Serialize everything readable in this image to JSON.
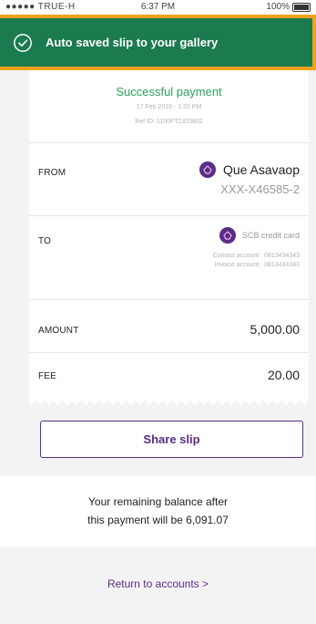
{
  "status_bar": {
    "carrier": "●●●●● TRUE-H",
    "time": "6:37 PM",
    "battery": "100%"
  },
  "toast": {
    "message": "Auto saved slip to your gallery"
  },
  "slip": {
    "status": "Successful payment",
    "date": "17 Feb 2016 - 1:20 PM",
    "ref": "Ref ID: 1100FT2325802",
    "from": {
      "label": "FROM",
      "name": "Que Asavaop",
      "account": "XXX-X46585-2"
    },
    "to": {
      "label": "TO",
      "name": "SCB credit card",
      "contact": "Contact account : 0813434343",
      "invoice": "Invoice account : 0813434343"
    },
    "amount": {
      "label": "AMOUNT",
      "value": "5,000.00"
    },
    "fee": {
      "label": "FEE",
      "value": "20.00"
    }
  },
  "actions": {
    "share_label": "Share slip",
    "return_label": "Return to accounts >"
  },
  "balance": {
    "line1": "Your remaining balance after",
    "line2": "this payment  will be 6,091.07"
  },
  "colors": {
    "toast_bg": "#1c7a4f",
    "toast_border": "#f0a21e",
    "success_green": "#2aa35a",
    "brand_purple": "#5a2d86"
  },
  "icons": {
    "toast": "check-circle-icon",
    "bank": "scb-bank-icon"
  }
}
